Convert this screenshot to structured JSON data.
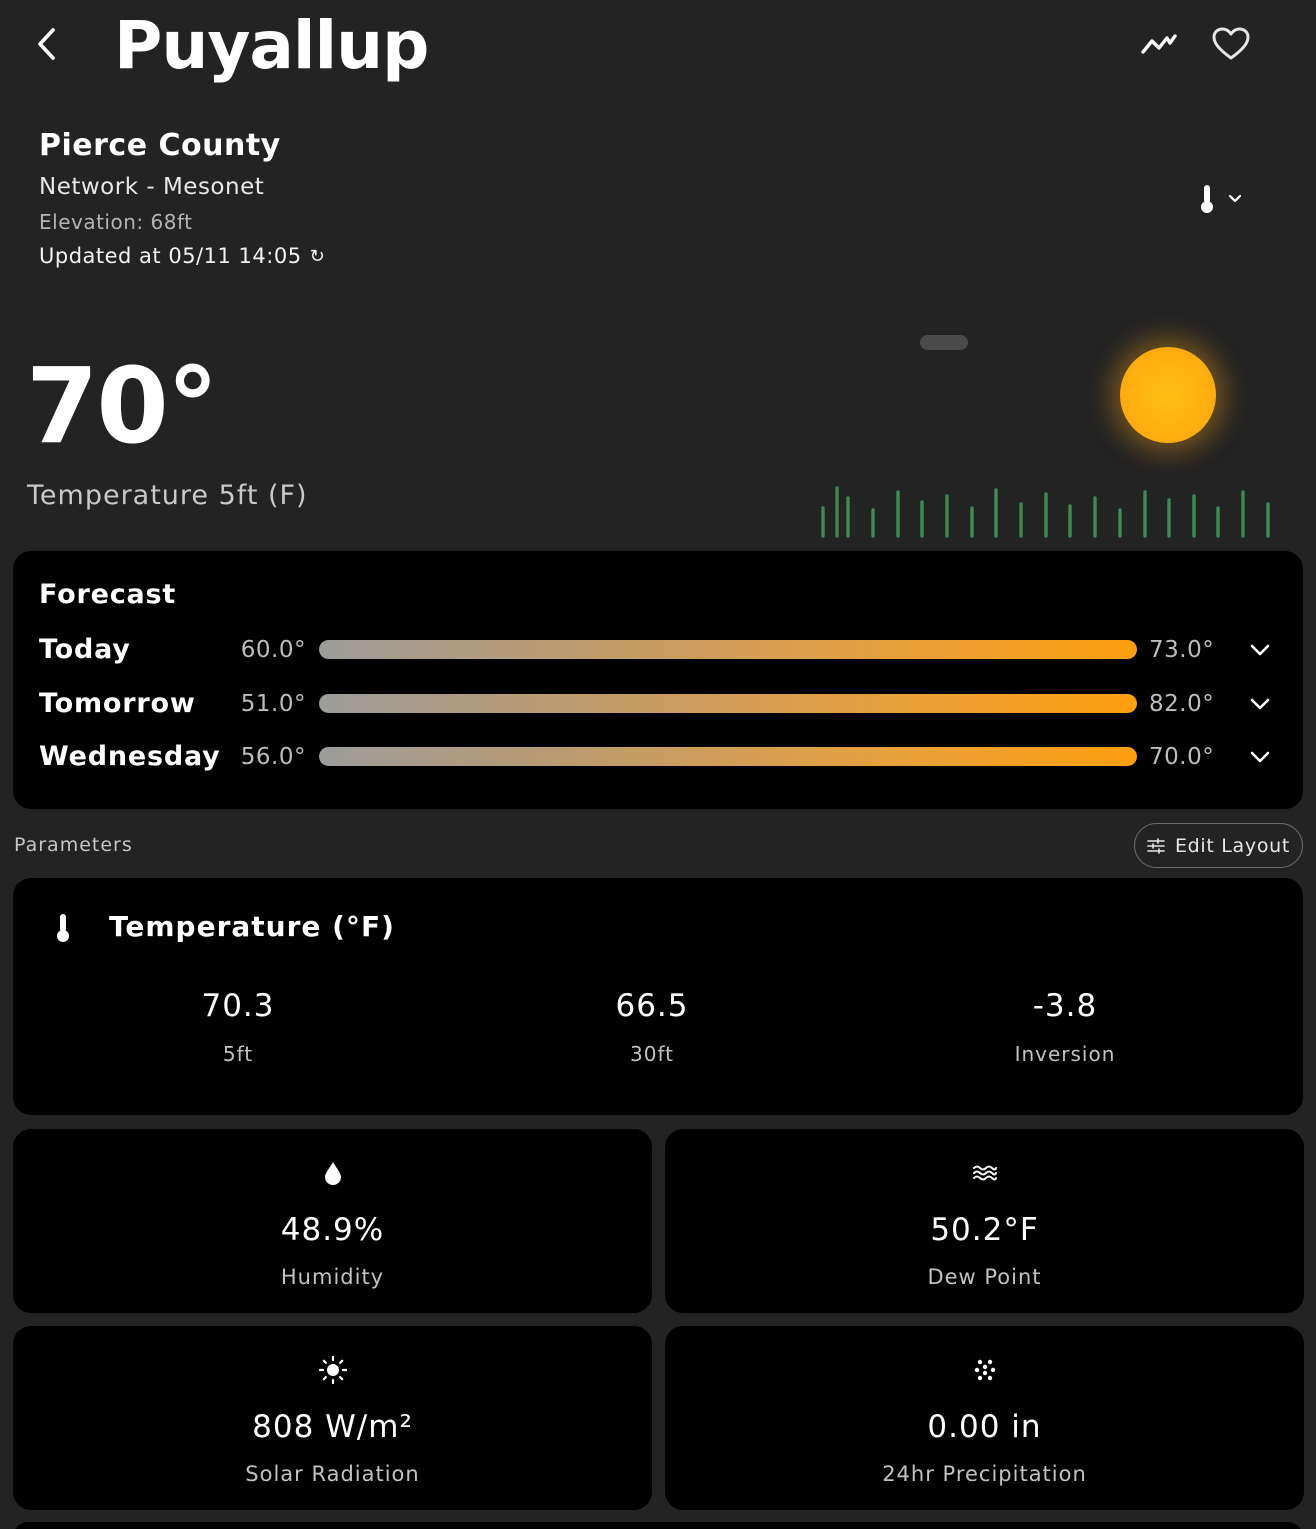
{
  "header": {
    "city": "Puyallup",
    "back_icon": "chevron-left-icon",
    "trend_icon": "trend-line-icon",
    "favorite_icon": "heart-outline-icon"
  },
  "station": {
    "county": "Pierce County",
    "network": "Network - Mesonet",
    "elevation": "Elevation: 68ft",
    "updated": "Updated at 05/11 14:05",
    "refresh_icon": "refresh-icon"
  },
  "parameter_selector": {
    "icon": "thermometer-icon",
    "chevron": "chevron-down-icon"
  },
  "current": {
    "temperature": "70°",
    "label": "Temperature 5ft (F)"
  },
  "forecast": {
    "title": "Forecast",
    "days": [
      {
        "day": "Today",
        "low": "60.0°",
        "high": "73.0°"
      },
      {
        "day": "Tomorrow",
        "low": "51.0°",
        "high": "82.0°"
      },
      {
        "day": "Wednesday",
        "low": "56.0°",
        "high": "70.0°"
      }
    ]
  },
  "parameters": {
    "label": "Parameters",
    "edit_layout": "Edit Layout"
  },
  "temperature_card": {
    "title": "Temperature (°F)",
    "values": [
      {
        "value": "70.3",
        "label": "5ft"
      },
      {
        "value": "66.5",
        "label": "30ft"
      },
      {
        "value": "-3.8",
        "label": "Inversion"
      }
    ]
  },
  "cards": {
    "humidity": {
      "value": "48.9%",
      "label": "Humidity",
      "icon": "droplet-icon"
    },
    "dew_point": {
      "value": "50.2°F",
      "label": "Dew Point",
      "icon": "waves-icon"
    },
    "solar": {
      "value": "808 W/m²",
      "label": "Solar Radiation",
      "icon": "sun-icon"
    },
    "precipitation": {
      "value": "0.00 in",
      "label": "24hr Precipitation",
      "icon": "rain-dots-icon"
    }
  },
  "colors": {
    "background": "#232323",
    "card": "#000000",
    "sun": "#fdad10",
    "grass": "#3f8a55",
    "bar_warm": "#ff9f10",
    "bar_cool": "#9c9c9c"
  }
}
